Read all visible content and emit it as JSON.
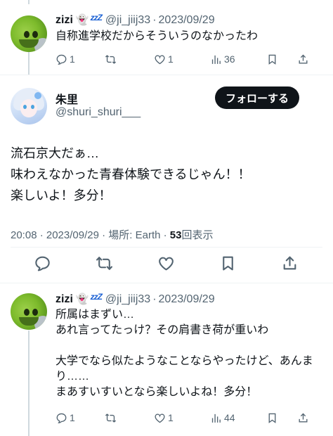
{
  "reply_top": {
    "name": "zizi",
    "emoji_ghost": "👻",
    "emoji_zzz": "zzZ",
    "handle": "@ji_jiij33",
    "dot": "·",
    "date": "2023/09/29",
    "text": "自称進学校だからそういうのなかったわ",
    "counts": {
      "reply": "1",
      "retweet": "",
      "like": "1",
      "views": "36"
    }
  },
  "main_tweet": {
    "name": "朱里",
    "handle": "@shuri_shuri___",
    "follow_label": "フォローする",
    "text": "流石京大だぁ…\n味わえなかった青春体験できるじゃん！！\n楽しいよ！多分！",
    "meta_time": "20:08 · 2023/09/29 · 場所: Earth · ",
    "views_count": "53",
    "views_label": "回表示"
  },
  "reply_bottom": {
    "name": "zizi",
    "emoji_ghost": "👻",
    "emoji_zzz": "zzZ",
    "handle": "@ji_jiij33",
    "dot": "·",
    "date": "2023/09/29",
    "text": "所属はまずい…\nあれ言ってたっけ？その肩書き荷が重いわ\n\n大学でなら似たようなことならやったけど、あんまり……\nまあすいすいとなら楽しいよね！多分！",
    "counts": {
      "reply": "1",
      "retweet": "",
      "like": "1",
      "views": "44"
    }
  }
}
